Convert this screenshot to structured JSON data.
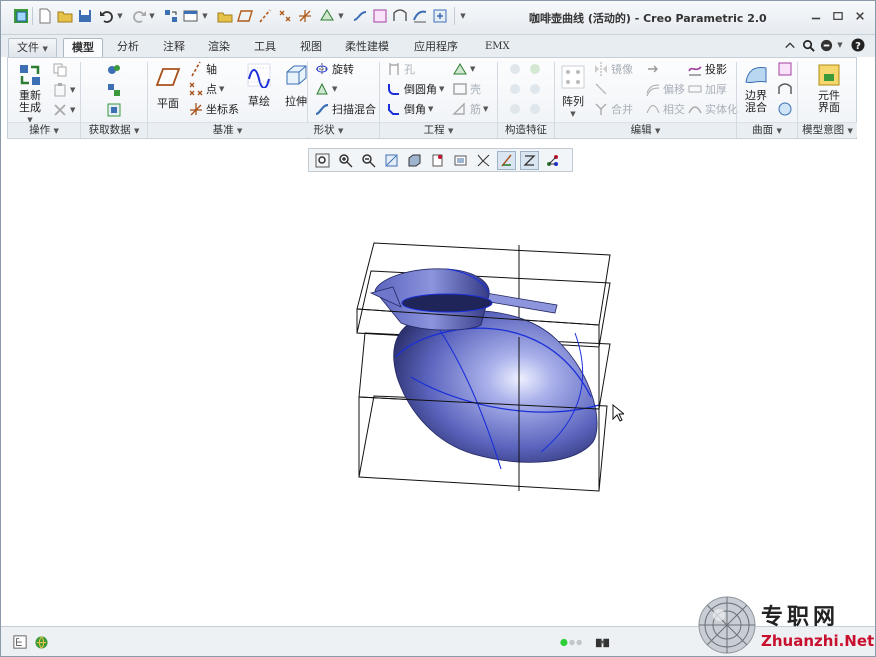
{
  "window": {
    "title": "咖啡壶曲线 (活动的) - Creo Parametric 2.0"
  },
  "tabs": [
    "文件",
    "模型",
    "分析",
    "注释",
    "渲染",
    "工具",
    "视图",
    "柔性建模",
    "应用程序",
    "EMX"
  ],
  "active_tab": "模型",
  "ribbon": {
    "operations": {
      "label": "操作",
      "regenerate": "重新生成"
    },
    "get_data": {
      "label": "获取数据"
    },
    "datum": {
      "label": "基准",
      "plane": "平面",
      "axis": "轴",
      "point": "点",
      "csys": "坐标系",
      "sketch": "草绘"
    },
    "shapes": {
      "label": "形状",
      "extrude": "拉伸",
      "revolve": "旋转",
      "sweep_blend": "扫描混合"
    },
    "engineering": {
      "label": "工程",
      "hole": "孔",
      "round": "倒圆角",
      "chamfer": "倒角",
      "shell": "壳",
      "rib": "筋"
    },
    "construct": {
      "label": "构造特征"
    },
    "editing": {
      "label": "编辑",
      "pattern": "阵列",
      "mirror": "镜像",
      "merge": "合并",
      "offset": "偏移",
      "intersect": "相交",
      "project": "投影",
      "thicken": "加厚",
      "solidify": "实体化"
    },
    "surfaces": {
      "label": "曲面",
      "boundary_blend": "边界混合"
    },
    "model_intent": {
      "label": "模型意图",
      "component_interface": "元件界面"
    }
  },
  "statusbar": {
    "status_lights": "green"
  },
  "watermark": {
    "cn": "专职网",
    "en": "Zhuanzhi.Net"
  },
  "colors": {
    "model_fill": "#6b74c8",
    "model_edge": "#1a2fd8",
    "accent_red": "#c8102e"
  }
}
